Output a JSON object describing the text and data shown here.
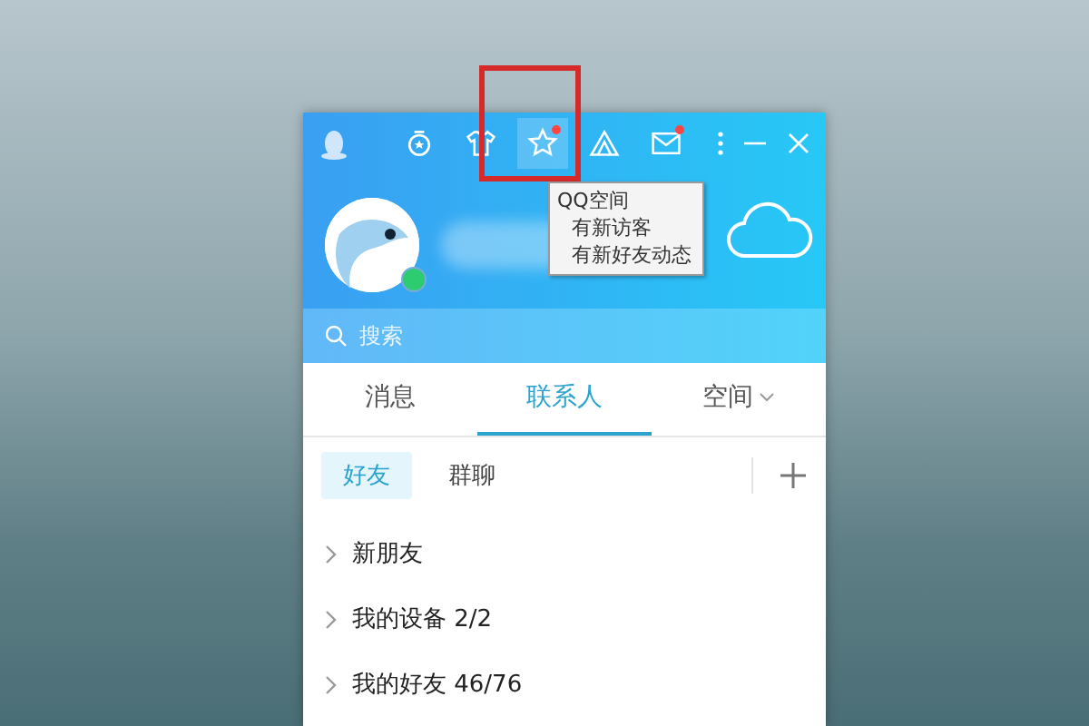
{
  "toolbar": {
    "buttons": [
      {
        "kind": "medal",
        "dot": false,
        "highlighted": false
      },
      {
        "kind": "shirt",
        "dot": false,
        "highlighted": false
      },
      {
        "kind": "star",
        "dot": true,
        "highlighted": true
      },
      {
        "kind": "triangle",
        "dot": false,
        "highlighted": false
      },
      {
        "kind": "mail",
        "dot": true,
        "highlighted": false
      }
    ]
  },
  "profile": {
    "online": true
  },
  "tooltip": {
    "title": "QQ空间",
    "lines": [
      "有新访客",
      "有新好友动态"
    ]
  },
  "search": {
    "placeholder": "搜索"
  },
  "tabs": [
    {
      "label": "消息",
      "selected": false,
      "has_menu": false
    },
    {
      "label": "联系人",
      "selected": true,
      "has_menu": false
    },
    {
      "label": "空间",
      "selected": false,
      "has_menu": true
    }
  ],
  "subtabs": [
    {
      "label": "好友",
      "selected": true
    },
    {
      "label": "群聊",
      "selected": false
    }
  ],
  "groups": [
    {
      "name": "新朋友"
    },
    {
      "name": "我的设备",
      "count": "2/2"
    },
    {
      "name": "我的好友",
      "count": "46/76"
    }
  ]
}
